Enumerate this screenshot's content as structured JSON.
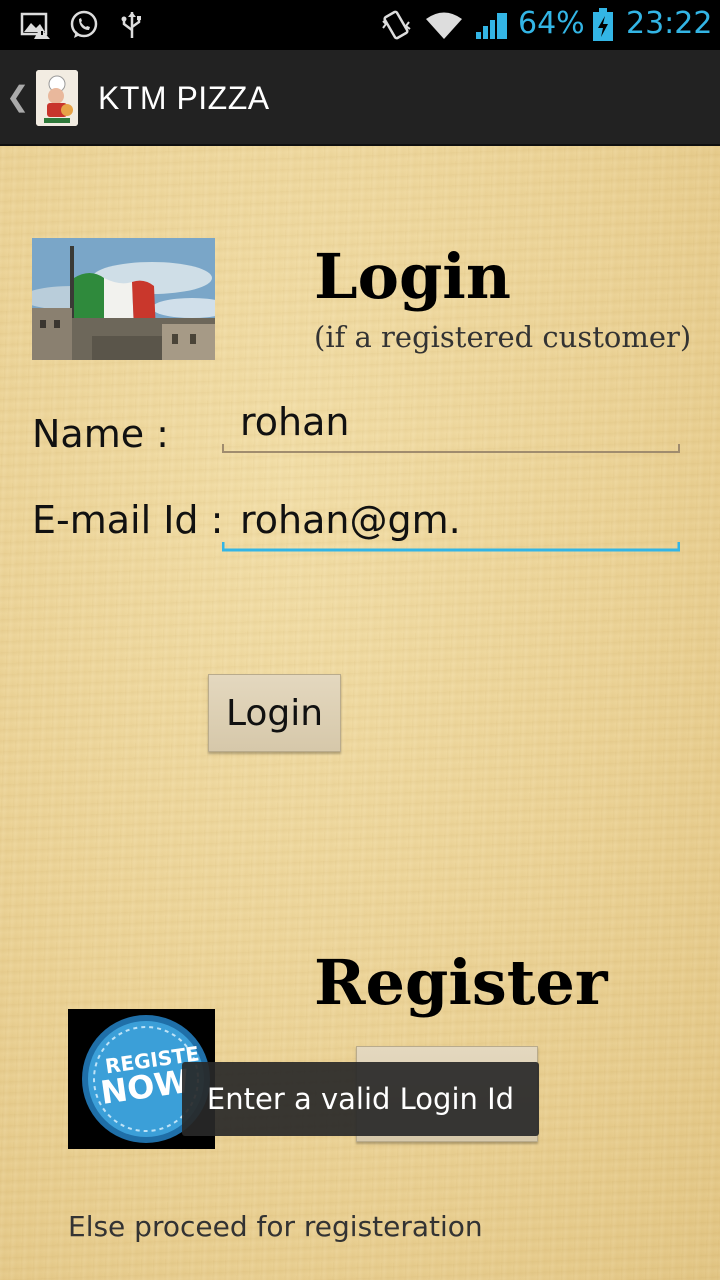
{
  "status_bar": {
    "battery_percent": "64%",
    "time": "23:22",
    "accent_color": "#33b5e5",
    "icons": [
      "gallery-notification-icon",
      "whatsapp-icon",
      "usb-icon",
      "vibrate-icon",
      "wifi-icon",
      "signal-icon",
      "battery-charging-icon"
    ]
  },
  "action_bar": {
    "title": "KTM PIZZA",
    "icon": "pizza-chef-icon"
  },
  "login": {
    "heading": "Login",
    "subtitle": "(if a registered customer)",
    "name_label": "Name :",
    "name_value": "rohan",
    "email_label": "E-mail Id :",
    "email_value": "rohan@gm.",
    "button_label": "Login",
    "focused_underline_color": "#33b5e5"
  },
  "register": {
    "heading": "Register",
    "badge_text_1": "REGISTE",
    "badge_text_2": "NOW",
    "footnote": "Else proceed for registeration"
  },
  "toast": {
    "message": "Enter a valid Login Id"
  }
}
